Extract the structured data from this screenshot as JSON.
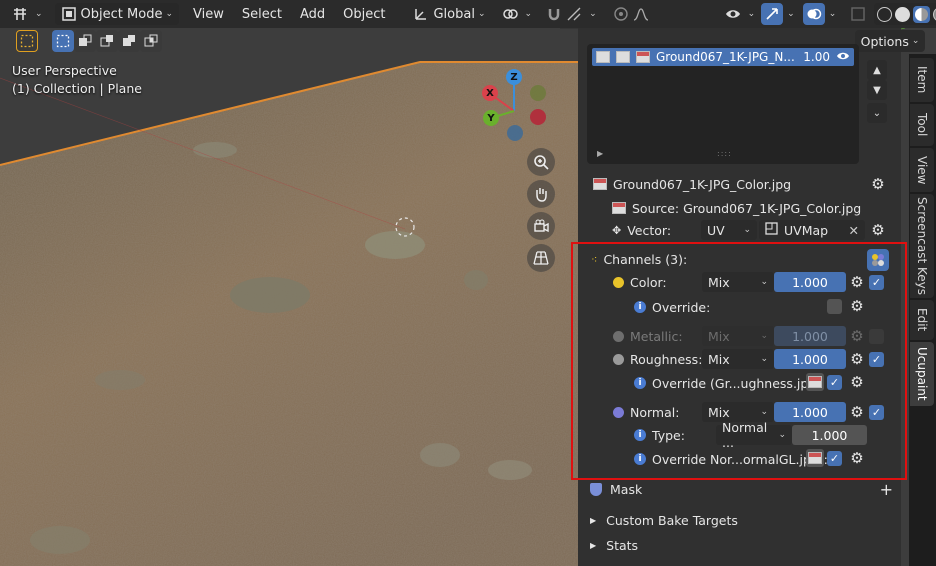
{
  "header": {
    "mode": "Object Mode",
    "menus": [
      "View",
      "Select",
      "Add",
      "Object"
    ],
    "transform_orientation": "Global",
    "options_label": "Options"
  },
  "viewport": {
    "perspective": "User Perspective",
    "collection": "(1) Collection | Plane",
    "gizmo": {
      "z": "Z",
      "x": "X",
      "y": "Y"
    }
  },
  "image_list": {
    "item_name": "Ground067_1K-JPG_N...",
    "item_value": "1.00"
  },
  "image": {
    "name": "Ground067_1K-JPG_Color.jpg",
    "source_label": "Source: Ground067_1K-JPG_Color.jpg",
    "vector_label": "Vector:",
    "vector_mode": "UV",
    "uvmap": "UVMap"
  },
  "channels": {
    "title": "Channels (3):",
    "color": {
      "label": "Color:",
      "blend": "Mix",
      "value": "1.000"
    },
    "override_label": "Override:",
    "metallic": {
      "label": "Metallic:",
      "blend": "Mix",
      "value": "1.000"
    },
    "roughness": {
      "label": "Roughness:",
      "blend": "Mix",
      "value": "1.000"
    },
    "roughness_override": "Override (Gr...ughness.jpg):",
    "normal": {
      "label": "Normal:",
      "blend": "Mix",
      "value": "1.000"
    },
    "normal_type_label": "Type:",
    "normal_type": "Normal ...",
    "normal_type_value": "1.000",
    "normal_override": "Override Nor...ormalGL.jpg):"
  },
  "panels": {
    "mask": "Mask",
    "bake_targets": "Custom Bake Targets",
    "stats": "Stats"
  },
  "tabs": [
    "Item",
    "Tool",
    "View",
    "Screencast Keys",
    "Edit",
    "Ucupaint"
  ],
  "colors": {
    "accent": "#4772b3",
    "highlight_border": "#e01010",
    "color_dot": "#e8c32a",
    "roughness_dot": "#9a9a9a",
    "normal_dot": "#7b7bd6"
  }
}
